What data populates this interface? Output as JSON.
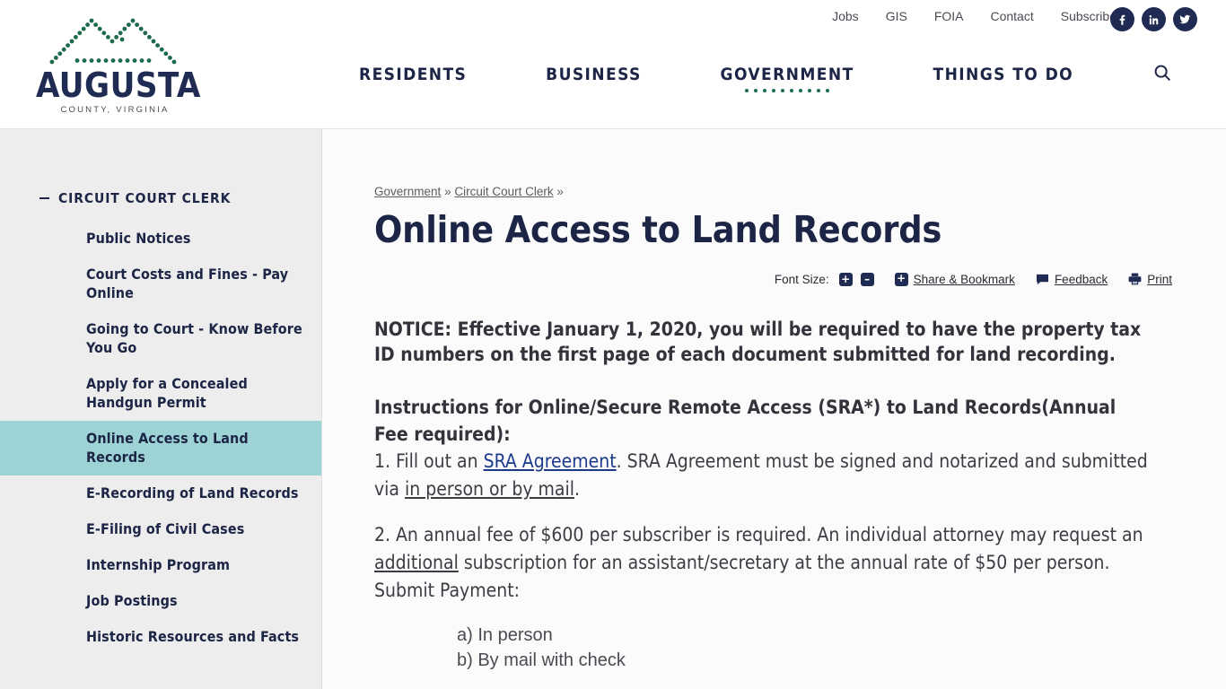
{
  "header": {
    "logo": {
      "icon": "mountain-dots-logo",
      "word": "AUGUSTA",
      "sub": "COUNTY, VIRGINIA"
    },
    "utility_links": [
      "Jobs",
      "GIS",
      "FOIA",
      "Contact",
      "Subscribe"
    ],
    "social": [
      {
        "name": "facebook-icon",
        "label": "Facebook"
      },
      {
        "name": "linkedin-icon",
        "label": "LinkedIn"
      },
      {
        "name": "twitter-icon",
        "label": "Twitter"
      }
    ],
    "nav": [
      {
        "label": "RESIDENTS",
        "active": false
      },
      {
        "label": "BUSINESS",
        "active": false
      },
      {
        "label": "GOVERNMENT",
        "active": true
      },
      {
        "label": "THINGS TO DO",
        "active": false
      }
    ],
    "search_icon": "search-icon"
  },
  "sidebar": {
    "section_title": "CIRCUIT COURT CLERK",
    "toggle_icon": "minus-icon",
    "items": [
      {
        "label": "Public Notices",
        "active": false
      },
      {
        "label": "Court Costs and Fines - Pay Online",
        "active": false
      },
      {
        "label": "Going to Court - Know Before You Go",
        "active": false
      },
      {
        "label": "Apply for a Concealed Handgun Permit",
        "active": false
      },
      {
        "label": "Online Access to Land Records",
        "active": true
      },
      {
        "label": "E-Recording of Land Records",
        "active": false
      },
      {
        "label": "E-Filing of Civil Cases",
        "active": false
      },
      {
        "label": "Internship Program",
        "active": false
      },
      {
        "label": "Job Postings",
        "active": false
      },
      {
        "label": "Historic Resources and Facts",
        "active": false
      }
    ]
  },
  "breadcrumb": {
    "items": [
      "Government",
      "Circuit Court Clerk"
    ],
    "separator": "»",
    "trailing": "»"
  },
  "page_title": "Online Access to Land Records",
  "toolbar": {
    "font_size_label": "Font Size:",
    "increase": "+",
    "decrease": "–",
    "share_plus": "+",
    "share_label": "Share & Bookmark",
    "feedback_label": "Feedback",
    "feedback_icon": "speech-bubble-icon",
    "print_label": "Print",
    "print_icon": "printer-icon"
  },
  "content": {
    "notice": "NOTICE: Effective January 1, 2020, you will be required to have the property tax ID numbers on the first page of each document submitted for land recording.",
    "instructions_heading": "Instructions for Online/Secure Remote Access (SRA*) to Land Records(Annual Fee required):",
    "step1": {
      "prefix": "1. Fill out an ",
      "link1": "SRA Agreement",
      "middle": ". SRA Agreement must be signed and notarized and submitted via ",
      "link2": "in person or by mail",
      "suffix": "."
    },
    "step2": {
      "prefix": "2. An annual fee of $600 per subscriber is required.   An individual attorney may request  an ",
      "link1": "additional",
      "suffix": " subscription for an assistant/secretary at the annual rate of $50 per person. Submit Payment:"
    },
    "payment_options": [
      "a) In person",
      "b) By mail with check"
    ]
  },
  "colors": {
    "navy": "#1c2545",
    "green": "#1b6b4a",
    "teal_active": "#9ed3d6",
    "sidebar_bg": "#ededed",
    "link_blue": "#1b3a8c"
  }
}
